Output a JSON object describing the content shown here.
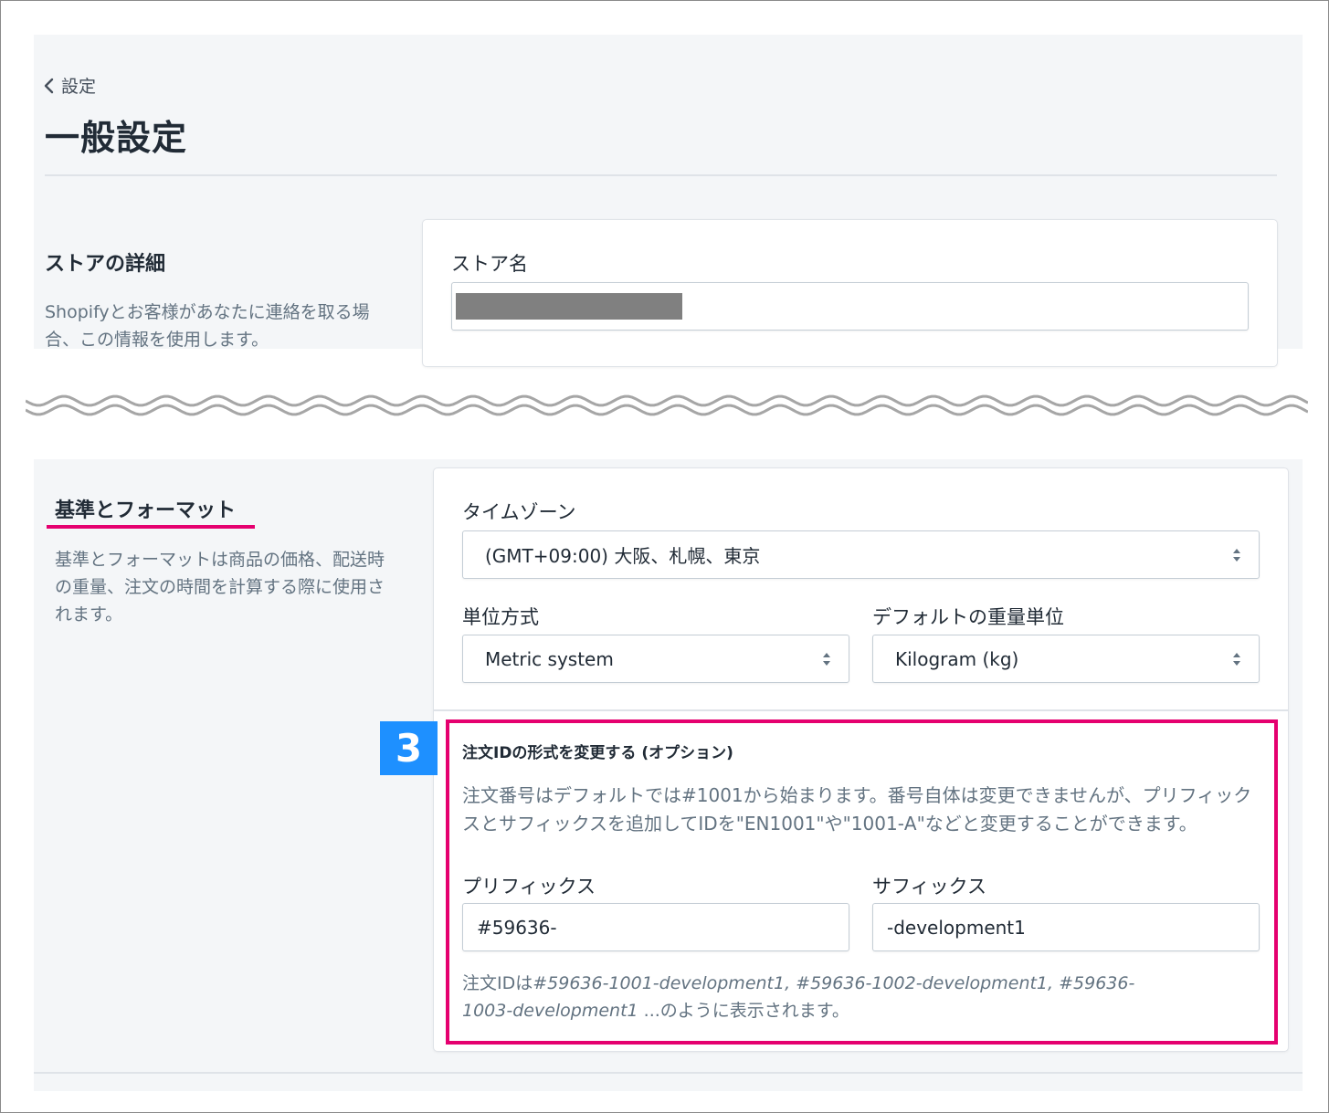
{
  "breadcrumb": {
    "label": "設定"
  },
  "page": {
    "title": "一般設定"
  },
  "store_details": {
    "heading": "ストアの詳細",
    "description": "Shopifyとお客様があなたに連絡を取る場合、この情報を使用します。",
    "store_name_label": "ストア名",
    "store_name_value": ""
  },
  "standards": {
    "heading": "基準とフォーマット",
    "description": "基準とフォーマットは商品の価格、配送時の重量、注文の時間を計算する際に使用されます。",
    "timezone_label": "タイムゾーン",
    "timezone_value": "(GMT+09:00) 大阪、札幌、東京",
    "unit_system_label": "単位方式",
    "unit_system_value": "Metric system",
    "weight_unit_label": "デフォルトの重量単位",
    "weight_unit_value": "Kilogram (kg)"
  },
  "order_id": {
    "step_badge": "3",
    "heading": "注文IDの形式を変更する (オプション)",
    "help": "注文番号はデフォルトでは#1001から始まります。番号自体は変更できませんが、プリフィックスとサフィックスを追加してIDを\"EN1001\"や\"1001-A\"などと変更することができます。",
    "prefix_label": "プリフィックス",
    "prefix_value": "#59636-",
    "suffix_label": "サフィックス",
    "suffix_value": "-development1",
    "example_prefix": "注文IDは",
    "example_ids": "#59636-1001-development1, #59636-1002-development1, #59636-1003-development1",
    "example_suffix": " ...のように表示されます。"
  },
  "colors": {
    "highlight": "#e5006f",
    "badge": "#1e90ff",
    "panel_bg": "#f4f6f8",
    "redacted": "#808080"
  }
}
